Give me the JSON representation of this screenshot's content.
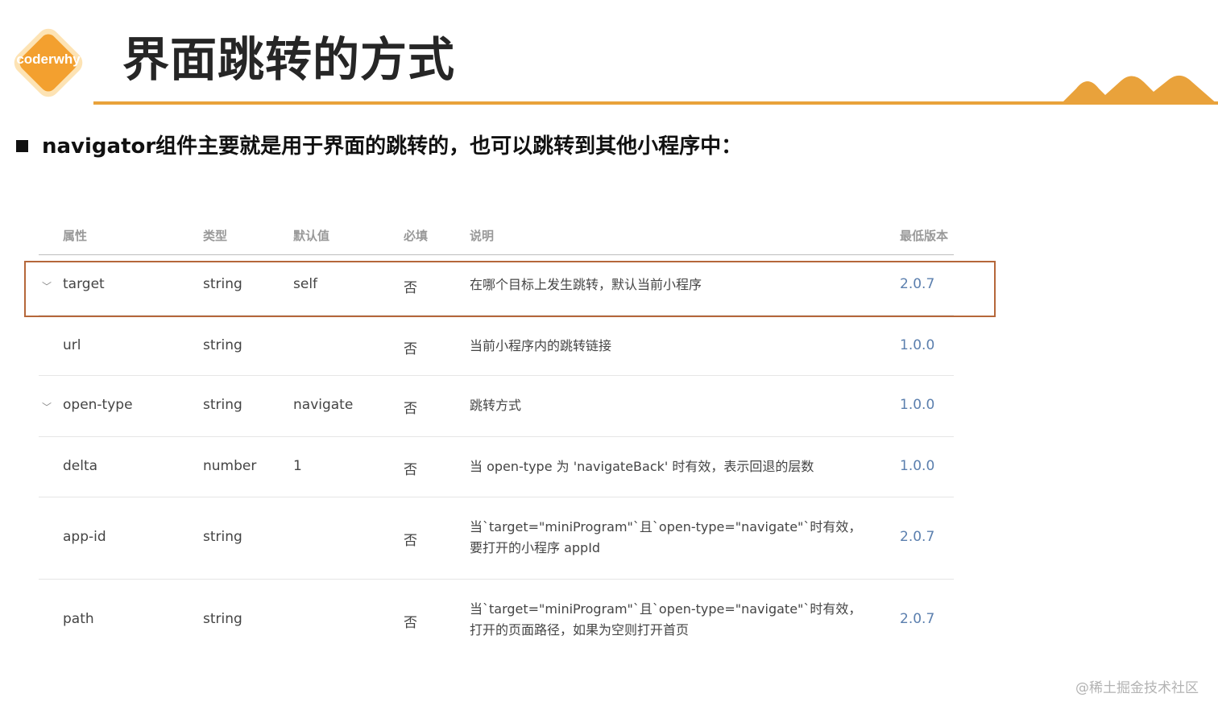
{
  "logo": {
    "text": "coderwhy",
    "color": "#f3a02f",
    "outline": "#fde3b4"
  },
  "slide": {
    "title": "界面跳转的方式",
    "accent": "#e9a23b"
  },
  "bullet_text": "navigator组件主要就是用于界面的跳转的，也可以跳转到其他小程序中：",
  "table": {
    "headers": [
      "属性",
      "类型",
      "默认值",
      "必填",
      "说明",
      "最低版本"
    ],
    "rows": [
      {
        "attr": "target",
        "type": "string",
        "default": "self",
        "required": "否",
        "desc1": "在哪个目标上发生跳转，默认当前小程序",
        "desc2": "",
        "version": "2.0.7",
        "expandable": true
      },
      {
        "attr": "url",
        "type": "string",
        "default": "",
        "required": "否",
        "desc1": "当前小程序内的跳转链接",
        "desc2": "",
        "version": "1.0.0",
        "expandable": false
      },
      {
        "attr": "open-type",
        "type": "string",
        "default": "navigate",
        "required": "否",
        "desc1": "跳转方式",
        "desc2": "",
        "version": "1.0.0",
        "expandable": true
      },
      {
        "attr": "delta",
        "type": "number",
        "default": "1",
        "required": "否",
        "desc1": "当 open-type 为 'navigateBack' 时有效，表示回退的层数",
        "desc2": "",
        "version": "1.0.0",
        "expandable": false
      },
      {
        "attr": "app-id",
        "type": "string",
        "default": "",
        "required": "否",
        "desc1": "当`target=\"miniProgram\"`且`open-type=\"navigate\"`时有效，",
        "desc2": "要打开的小程序 appId",
        "version": "2.0.7",
        "expandable": false
      },
      {
        "attr": "path",
        "type": "string",
        "default": "",
        "required": "否",
        "desc1": "当`target=\"miniProgram\"`且`open-type=\"navigate\"`时有效，",
        "desc2": "打开的页面路径，如果为空则打开首页",
        "version": "2.0.7",
        "expandable": false
      }
    ]
  },
  "watermark": "@稀土掘金技术社区"
}
